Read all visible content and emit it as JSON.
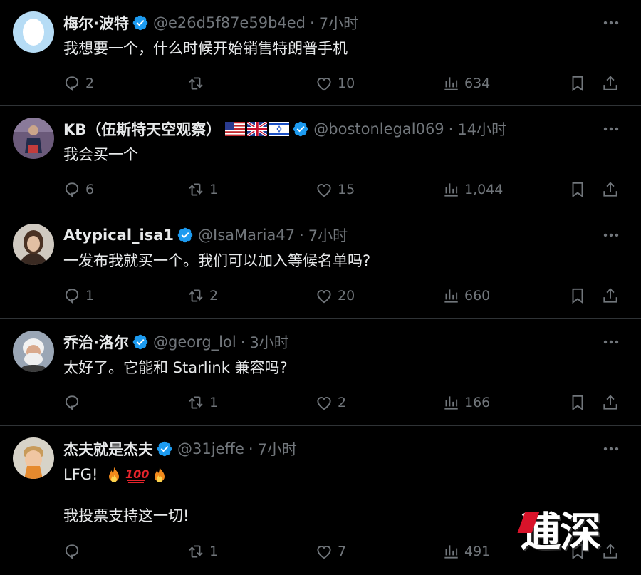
{
  "tweets": [
    {
      "name": "梅尔·波特",
      "handle": "@e26d5f87e59b4ed",
      "time": "7小时",
      "text": [
        "我想要一个，什么时候开始销售特朗普手机"
      ],
      "replies": "2",
      "retweets": "",
      "likes": "10",
      "views": "634",
      "flags": []
    },
    {
      "name": "KB（伍斯特天空观察）",
      "handle": "@bostonlegal069",
      "time": "14小时",
      "text": [
        "我会买一个"
      ],
      "replies": "6",
      "retweets": "1",
      "likes": "15",
      "views": "1,044",
      "flags": [
        "us-flag",
        "uk-flag",
        "israel-flag"
      ]
    },
    {
      "name": "Atypical_isa1",
      "handle": "@IsaMaria47",
      "time": "7小时",
      "text": [
        "一发布我就买一个。我们可以加入等候名单吗?"
      ],
      "replies": "1",
      "retweets": "2",
      "likes": "20",
      "views": "660",
      "flags": []
    },
    {
      "name": "乔治·洛尔",
      "handle": "@georg_lol",
      "time": "3小时",
      "text": [
        "太好了。它能和 Starlink 兼容吗?"
      ],
      "replies": "",
      "retweets": "1",
      "likes": "2",
      "views": "166",
      "flags": []
    },
    {
      "name": "杰夫就是杰夫",
      "handle": "@31jeffe",
      "time": "7小时",
      "text": [
        "LFG!",
        "我投票支持这一切!"
      ],
      "emoji": [
        "fire-emoji",
        "hundred-points-emoji",
        "fire-emoji"
      ],
      "replies": "",
      "retweets": "1",
      "likes": "7",
      "views": "491",
      "flags": []
    }
  ],
  "dot": "·",
  "watermark": "逋深",
  "colors": {
    "background": "#000000",
    "text": "#e7e9ea",
    "muted": "#71767b",
    "verified": "#1d9bf0",
    "divider": "#2f3336"
  }
}
